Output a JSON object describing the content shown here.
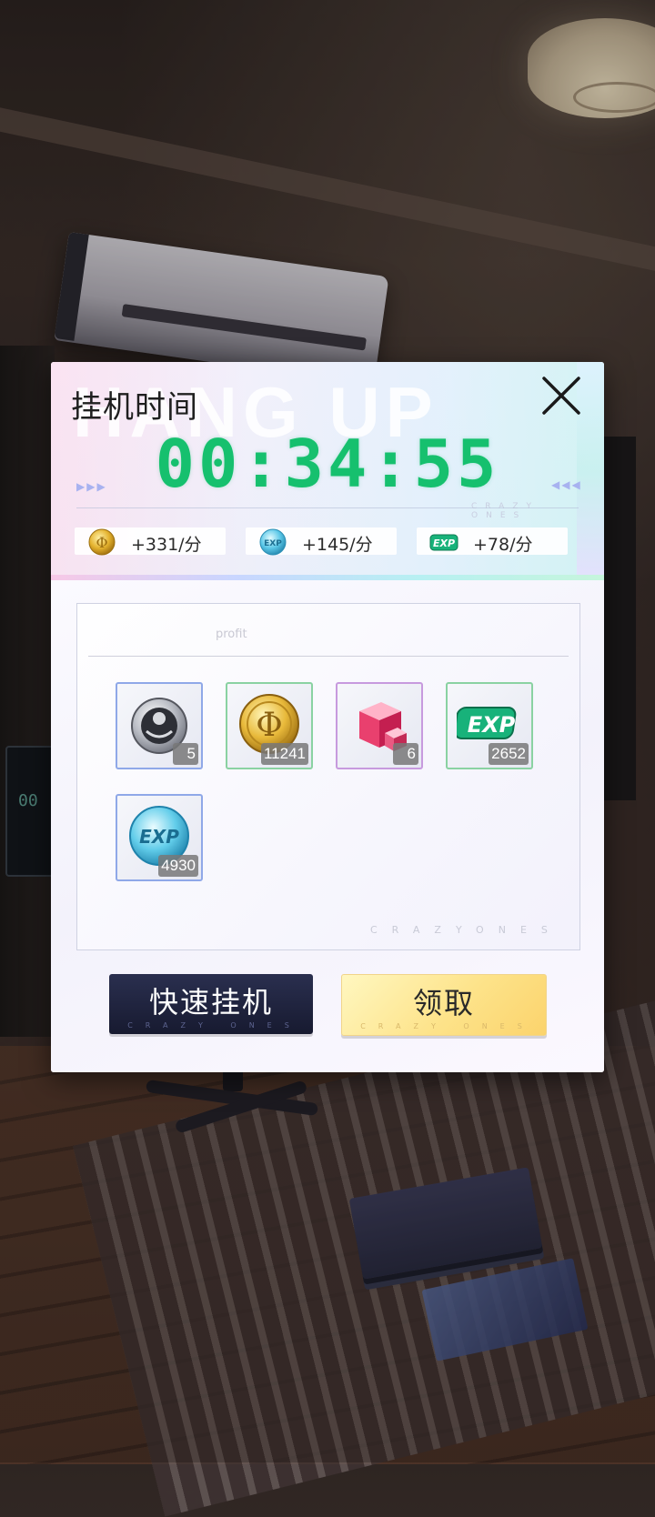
{
  "dialog": {
    "title": "挂机时间",
    "bg_word": "HANG UP",
    "timer": "00:34:55",
    "deco_left": "▶▶▶",
    "deco_right": "◀◀◀",
    "deco_brand": "CRAZY ONES",
    "rates": [
      {
        "icon": "gold-coin-icon",
        "text": "+331/分"
      },
      {
        "icon": "exp-coin-icon",
        "text": "+145/分"
      },
      {
        "icon": "exp-badge-icon",
        "text": "+78/分"
      }
    ]
  },
  "profit": {
    "label": "profit",
    "footer": "CRAZYONES",
    "items": [
      {
        "icon": "silver-medal-icon",
        "qty": "5"
      },
      {
        "icon": "gold-coin-icon",
        "qty": "11241"
      },
      {
        "icon": "pink-cube-icon",
        "qty": "6"
      },
      {
        "icon": "exp-badge-icon",
        "qty": "2652"
      },
      {
        "icon": "exp-coin-icon",
        "qty": "4930"
      }
    ]
  },
  "buttons": {
    "quick": "快速挂机",
    "claim": "领取",
    "sub_brand": "CRAZY ONES"
  },
  "colors": {
    "timer": "#16c06e",
    "claim_button": "#fde38a",
    "quick_button": "#1f2340"
  }
}
